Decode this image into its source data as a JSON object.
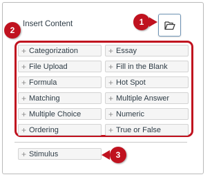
{
  "panel": {
    "title": "Insert Content"
  },
  "callouts": {
    "one": "1",
    "two": "2",
    "three": "3"
  },
  "colors": {
    "callout": "#c0121f",
    "accent": "#2d3b45"
  },
  "icons": {
    "open_content": "folder-open-icon",
    "add": "plus-icon"
  },
  "question_types": {
    "left": [
      "Categorization",
      "File Upload",
      "Formula",
      "Matching",
      "Multiple Choice",
      "Ordering"
    ],
    "right": [
      "Essay",
      "Fill in the Blank",
      "Hot Spot",
      "Multiple Answer",
      "Numeric",
      "True or False"
    ]
  },
  "stimulus": {
    "label": "Stimulus"
  }
}
